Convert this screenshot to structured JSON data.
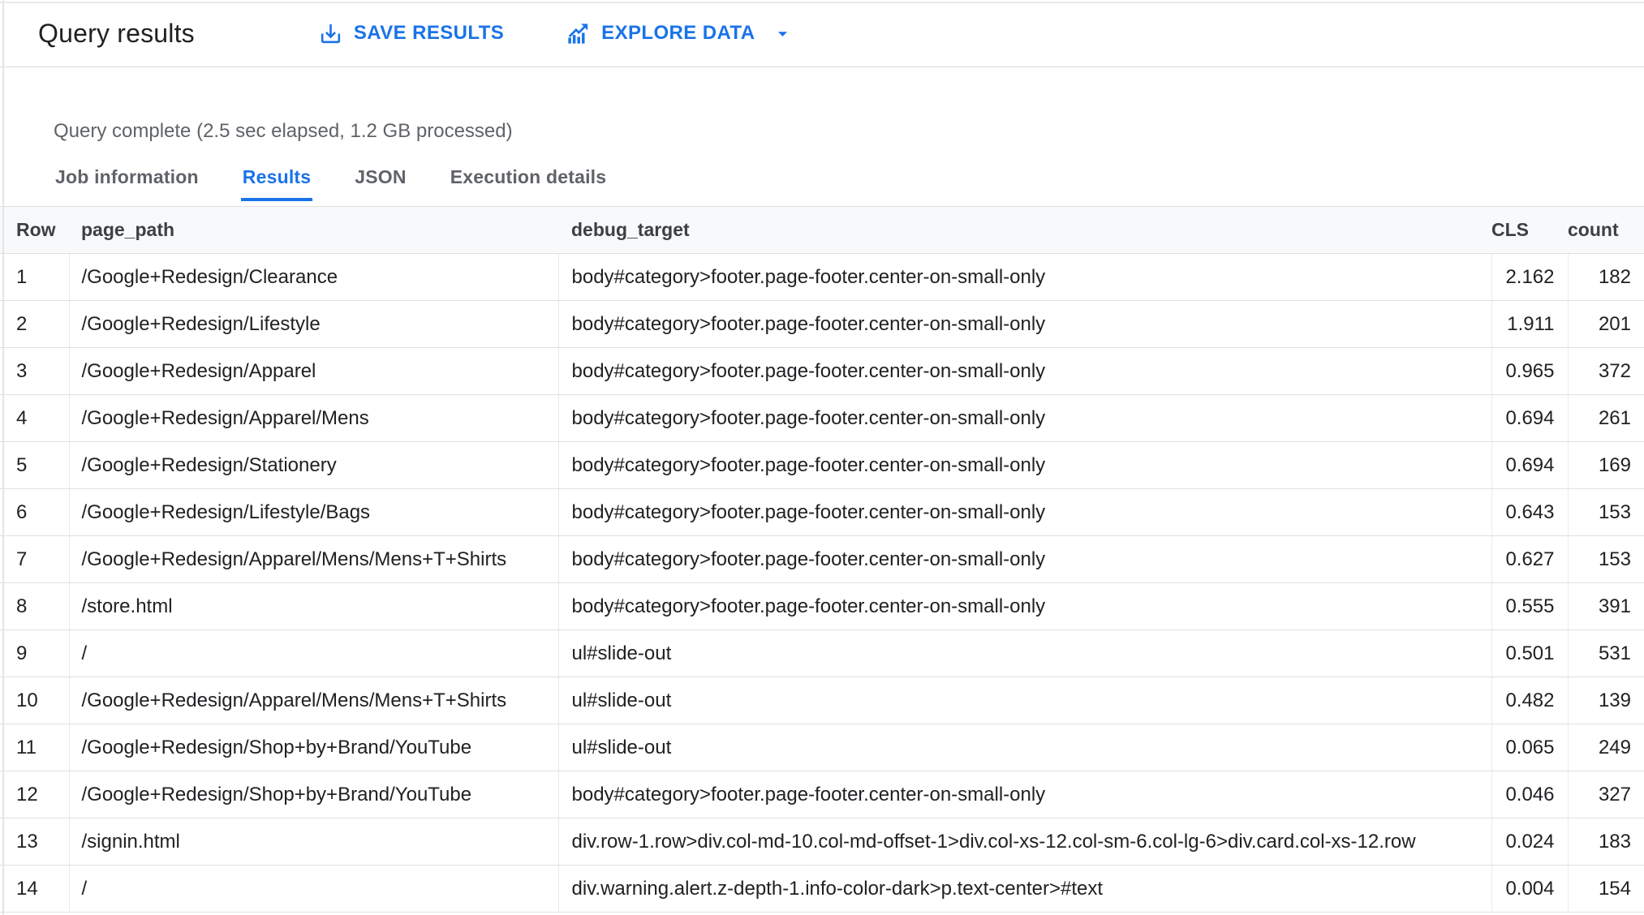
{
  "header": {
    "title": "Query results",
    "save_button": {
      "label": "SAVE RESULTS",
      "icon": "download-icon"
    },
    "explore_button": {
      "label": "EXPLORE DATA",
      "icon": "bar-chart-icon",
      "dropdown_icon": "chevron-down-icon"
    }
  },
  "status_text": "Query complete (2.5 sec elapsed, 1.2 GB processed)",
  "tabs": [
    {
      "label": "Job information",
      "active": false
    },
    {
      "label": "Results",
      "active": true
    },
    {
      "label": "JSON",
      "active": false
    },
    {
      "label": "Execution details",
      "active": false
    }
  ],
  "table": {
    "columns": [
      "Row",
      "page_path",
      "debug_target",
      "CLS",
      "count"
    ],
    "rows": [
      {
        "row": "1",
        "page_path": "/Google+Redesign/Clearance",
        "debug_target": "body#category>footer.page-footer.center-on-small-only",
        "cls": "2.162",
        "count": "182"
      },
      {
        "row": "2",
        "page_path": "/Google+Redesign/Lifestyle",
        "debug_target": "body#category>footer.page-footer.center-on-small-only",
        "cls": "1.911",
        "count": "201"
      },
      {
        "row": "3",
        "page_path": "/Google+Redesign/Apparel",
        "debug_target": "body#category>footer.page-footer.center-on-small-only",
        "cls": "0.965",
        "count": "372"
      },
      {
        "row": "4",
        "page_path": "/Google+Redesign/Apparel/Mens",
        "debug_target": "body#category>footer.page-footer.center-on-small-only",
        "cls": "0.694",
        "count": "261"
      },
      {
        "row": "5",
        "page_path": "/Google+Redesign/Stationery",
        "debug_target": "body#category>footer.page-footer.center-on-small-only",
        "cls": "0.694",
        "count": "169"
      },
      {
        "row": "6",
        "page_path": "/Google+Redesign/Lifestyle/Bags",
        "debug_target": "body#category>footer.page-footer.center-on-small-only",
        "cls": "0.643",
        "count": "153"
      },
      {
        "row": "7",
        "page_path": "/Google+Redesign/Apparel/Mens/Mens+T+Shirts",
        "debug_target": "body#category>footer.page-footer.center-on-small-only",
        "cls": "0.627",
        "count": "153"
      },
      {
        "row": "8",
        "page_path": "/store.html",
        "debug_target": "body#category>footer.page-footer.center-on-small-only",
        "cls": "0.555",
        "count": "391"
      },
      {
        "row": "9",
        "page_path": "/",
        "debug_target": "ul#slide-out",
        "cls": "0.501",
        "count": "531"
      },
      {
        "row": "10",
        "page_path": "/Google+Redesign/Apparel/Mens/Mens+T+Shirts",
        "debug_target": "ul#slide-out",
        "cls": "0.482",
        "count": "139"
      },
      {
        "row": "11",
        "page_path": "/Google+Redesign/Shop+by+Brand/YouTube",
        "debug_target": "ul#slide-out",
        "cls": "0.065",
        "count": "249"
      },
      {
        "row": "12",
        "page_path": "/Google+Redesign/Shop+by+Brand/YouTube",
        "debug_target": "body#category>footer.page-footer.center-on-small-only",
        "cls": "0.046",
        "count": "327"
      },
      {
        "row": "13",
        "page_path": "/signin.html",
        "debug_target": "div.row-1.row>div.col-md-10.col-md-offset-1>div.col-xs-12.col-sm-6.col-lg-6>div.card.col-xs-12.row",
        "cls": "0.024",
        "count": "183"
      },
      {
        "row": "14",
        "page_path": "/",
        "debug_target": "div.warning.alert.z-depth-1.info-color-dark>p.text-center>#text",
        "cls": "0.004",
        "count": "154"
      }
    ]
  },
  "colors": {
    "accent_blue": "#1a73e8",
    "table_header_bg": "#f8f9fa",
    "row_border": "#e0e0e0",
    "text_primary": "#202124",
    "text_secondary": "#5f6368"
  }
}
